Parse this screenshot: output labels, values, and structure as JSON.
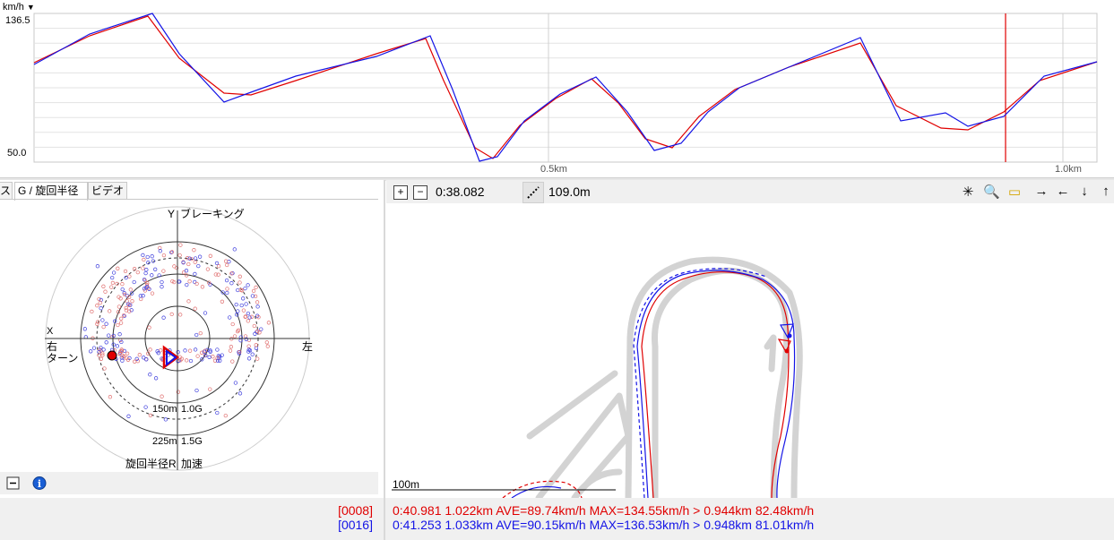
{
  "speed_chart": {
    "unit_label": "km/h",
    "unit_dropdown_glyph": "▼",
    "y_max_label": "136.5",
    "y_min_label": "50.0",
    "x_ticks": [
      "0.5km",
      "1.0km"
    ],
    "cursor_color": "#e00000"
  },
  "tabs": [
    {
      "label": "ス",
      "active": false
    },
    {
      "label": "G / 旋回半径",
      "active": true
    },
    {
      "label": "ビデオ",
      "active": false
    }
  ],
  "g_panel": {
    "axis_y_label": "Y",
    "braking_label": "ブレーキング",
    "axis_x_label": "X",
    "right_label": "右",
    "turn_label": "ターン",
    "left_label": "左",
    "ring_labels": [
      {
        "radius": "150m",
        "g": "1.0G"
      },
      {
        "radius": "225m",
        "g": "1.5G"
      }
    ],
    "radius_r_label": "旋回半径R",
    "accel_label": "加速"
  },
  "g_bottom": {
    "collapse_icon": "minus-box-icon",
    "info_icon": "info-icon"
  },
  "map_toolbar": {
    "zoom_in_glyph": "+",
    "zoom_out_glyph": "−",
    "time": "0:38.082",
    "distance": "109.0m",
    "icons": [
      "sparkle-icon",
      "search-folder-icon",
      "open-folder-icon",
      "arrow-right-icon",
      "arrow-left-icon",
      "arrow-down-icon",
      "arrow-up-icon"
    ]
  },
  "map": {
    "scale_label": "100m"
  },
  "laps": [
    {
      "id": "[0008]",
      "summary": "0:40.981 1.022km AVE=89.74km/h MAX=134.55km/h > 0.944km 82.48km/h",
      "color": "#e00000"
    },
    {
      "id": "[0016]",
      "summary": "0:41.253 1.033km AVE=90.15km/h MAX=136.53km/h > 0.948km 81.01km/h",
      "color": "#1414e6"
    }
  ]
}
